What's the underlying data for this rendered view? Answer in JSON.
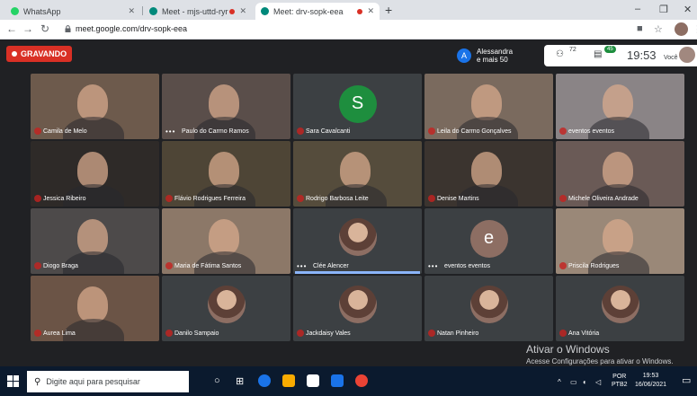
{
  "browser": {
    "tabs": [
      {
        "label": "WhatsApp",
        "favicon_color": "#25d366"
      },
      {
        "label": "Meet - mjs-uttd-ryr",
        "favicon_color": "#00897b",
        "recording": true
      },
      {
        "label": "Meet: drv-sopk-eea",
        "favicon_color": "#00897b",
        "recording": true,
        "active": true
      }
    ],
    "new_tab_label": "+",
    "window_controls": [
      "–",
      "❐",
      "✕"
    ],
    "url": "meet.google.com/drv-sopk-eea"
  },
  "meet": {
    "recording_label": "GRAVANDO",
    "presenter": {
      "initial": "A",
      "line1": "Alessandra",
      "line2": "e mais 50"
    },
    "participants_count": "72",
    "chat_badge": "45",
    "clock": "19:53",
    "self_label": "Você",
    "tiles": [
      {
        "name": "Camila de Melo",
        "kind": "video",
        "bg": "#6d5a4c",
        "mic_off": true
      },
      {
        "name": "Paulo do Carmo Ramos",
        "kind": "video",
        "bg": "#5a4e4a",
        "more": true
      },
      {
        "name": "Sara Cavalcanti",
        "kind": "avatar",
        "initial": "S",
        "avatar_color": "#1e8e3e",
        "bg": "#3c4043",
        "mic_off": true
      },
      {
        "name": "Leila do Carmo Gonçalves",
        "kind": "video",
        "bg": "#7a6a5e",
        "mic_off": true
      },
      {
        "name": "eventos eventos",
        "kind": "video",
        "bg": "#8a8486",
        "mic_off": true
      },
      {
        "name": "Jessica Ribeiro",
        "kind": "video",
        "bg": "#2e2a28",
        "mic_off": true
      },
      {
        "name": "Flávio Rodrigues Ferreira",
        "kind": "video",
        "bg": "#4e4536",
        "mic_off": true
      },
      {
        "name": "Rodrigo Barbosa Leite",
        "kind": "video",
        "bg": "#554c3c",
        "mic_off": true
      },
      {
        "name": "Denise Martins",
        "kind": "video",
        "bg": "#3b342f",
        "mic_off": true
      },
      {
        "name": "Michele Oliveira Andrade",
        "kind": "video",
        "bg": "#6a5a56",
        "mic_off": true
      },
      {
        "name": "Diogo Braga",
        "kind": "video",
        "bg": "#4d4a4a",
        "mic_off": true
      },
      {
        "name": "Maria de Fátima Santos",
        "kind": "video",
        "bg": "#8c7868",
        "mic_off": true
      },
      {
        "name": "Clée Alencer",
        "kind": "photo",
        "bg": "#3c4043",
        "more": true,
        "speaking": true
      },
      {
        "name": "eventos eventos",
        "kind": "avatar",
        "initial": "e",
        "avatar_color": "#8d6e63",
        "bg": "#3c4043",
        "more": true
      },
      {
        "name": "Priscila Rodrigues",
        "kind": "video",
        "bg": "#9a8878",
        "mic_off": true
      },
      {
        "name": "Aurea Lima",
        "kind": "video",
        "bg": "#6b5446",
        "mic_off": true
      },
      {
        "name": "Danilo Sampaio",
        "kind": "photo",
        "bg": "#3c4043",
        "mic_off": true
      },
      {
        "name": "Jackdaisy Vales",
        "kind": "photo",
        "bg": "#3c4043",
        "mic_off": true
      },
      {
        "name": "Natan Pinheiro",
        "kind": "photo",
        "bg": "#3c4043",
        "mic_off": true
      },
      {
        "name": "Ana Vitória",
        "kind": "photo",
        "bg": "#3c4043",
        "mic_off": true
      }
    ],
    "watermark_title": "Ativar o Windows",
    "watermark_text": "Acesse Configurações para ativar o Windows."
  },
  "taskbar": {
    "search_placeholder": "Digite aqui para pesquisar",
    "lang": "POR",
    "lang_sub": "PTB2",
    "time": "19:53",
    "date": "16/06/2021"
  }
}
